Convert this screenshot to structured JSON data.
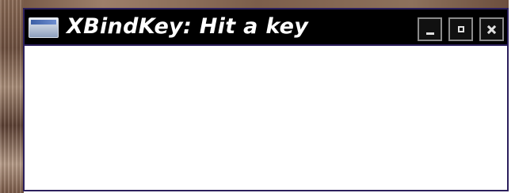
{
  "window": {
    "title": "XBindKey: Hit a key",
    "app_icon": "window-icon",
    "controls": {
      "minimize_icon": "minimize-icon",
      "maximize_icon": "maximize-icon",
      "close_icon": "close-icon"
    }
  },
  "colors": {
    "titlebar_background": "#000000",
    "title_text": "#ffffff",
    "window_border": "#2b1f5c",
    "content_background": "#ffffff"
  }
}
